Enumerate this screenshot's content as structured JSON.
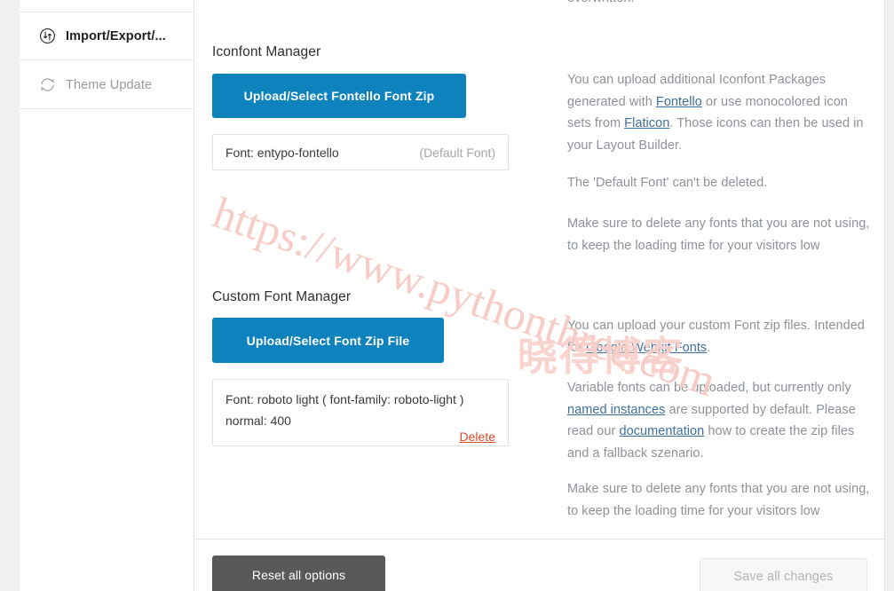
{
  "sidebar": {
    "items": [
      {
        "label": "Import/Export/...",
        "icon": "import-export-icon",
        "active": true
      },
      {
        "label": "Theme Update",
        "icon": "refresh-icon",
        "active": false
      }
    ]
  },
  "main": {
    "top_cut_text": "overwritten.",
    "iconfont": {
      "title": "Iconfont Manager",
      "upload_button": "Upload/Select Fontello Font Zip",
      "font_entry": {
        "name": "Font: entypo-fontello",
        "tag": "(Default Font)"
      },
      "help": {
        "p1_before_link1": "You can upload additional Iconfont Packages generated with ",
        "link1": "Fontello",
        "p1_between": " or use monocolored icon sets from ",
        "link2": "Flaticon",
        "p1_after": ". Those icons can then be used in your Layout Builder.",
        "p2": "The 'Default Font' can't be deleted.",
        "p3": "Make sure to delete any fonts that you are not using, to keep the loading time for your visitors low"
      }
    },
    "customfont": {
      "title": "Custom Font Manager",
      "upload_button": "Upload/Select Font Zip File",
      "font_entry": {
        "line1": "Font: roboto light ( font-family: roboto-light )",
        "line2": "normal: 400",
        "delete_label": "Delete"
      },
      "help": {
        "p1_before_link": "You can upload your custom Font zip files. Intended for ",
        "link1": "Google Webkit Fonts",
        "p1_after": ".",
        "p2_before_link": "Variable fonts can be uploaded, but currently only ",
        "link2": "named instances",
        "p2_between": " are supported by default. Please read our ",
        "link3": "documentation",
        "p2_after": " how to create the zip files and a fallback szenario.",
        "p3": "Make sure to delete any fonts that you are not using, to keep the loading time for your visitors low"
      }
    }
  },
  "footer": {
    "reset_label": "Reset all options",
    "save_label": "Save all changes"
  },
  "watermark": {
    "url": "https://www.pythonthree.com",
    "cn": "晓得博客"
  },
  "colors": {
    "accent_blue": "#0e82bd",
    "reset_gray": "#595959",
    "delete_orange": "#d84a26",
    "link_blue": "#3f6f9e",
    "help_text": "#8d9299",
    "watermark_pink": "#f7c9c4"
  }
}
